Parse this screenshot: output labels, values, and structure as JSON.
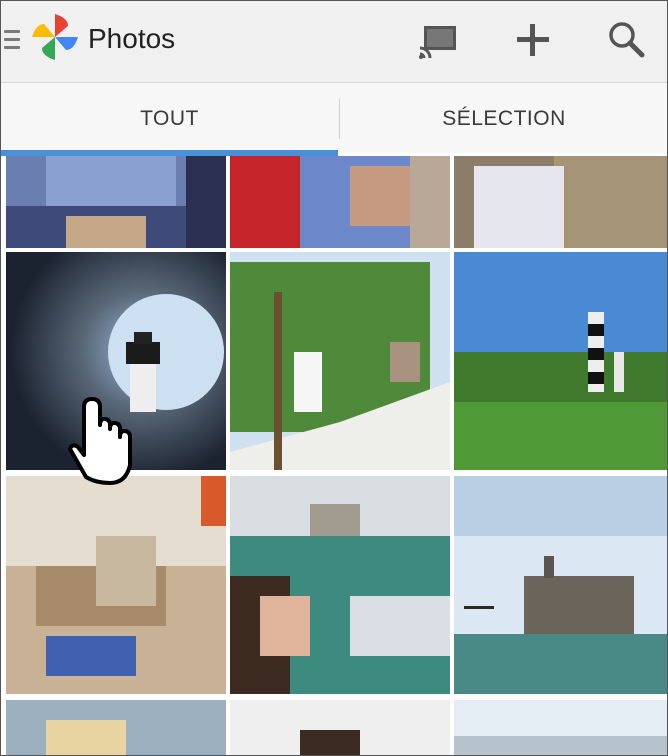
{
  "app": {
    "title": "Photos"
  },
  "toolbar": {
    "menu_icon": "hamburger-menu-icon",
    "logo_icon": "photos-pinwheel-logo",
    "cast_icon": "cast-icon",
    "add_icon": "add-icon",
    "search_icon": "search-icon"
  },
  "tabs": [
    {
      "label": "TOUT",
      "selected": true
    },
    {
      "label": "SÉLECTION",
      "selected": false
    }
  ],
  "colors": {
    "accent": "#4a90d9",
    "appbar": "#f0f0f0",
    "tabbar": "#f7f7f7",
    "text": "#222222"
  },
  "pointer": {
    "icon": "hand-pointer-cursor-icon"
  }
}
